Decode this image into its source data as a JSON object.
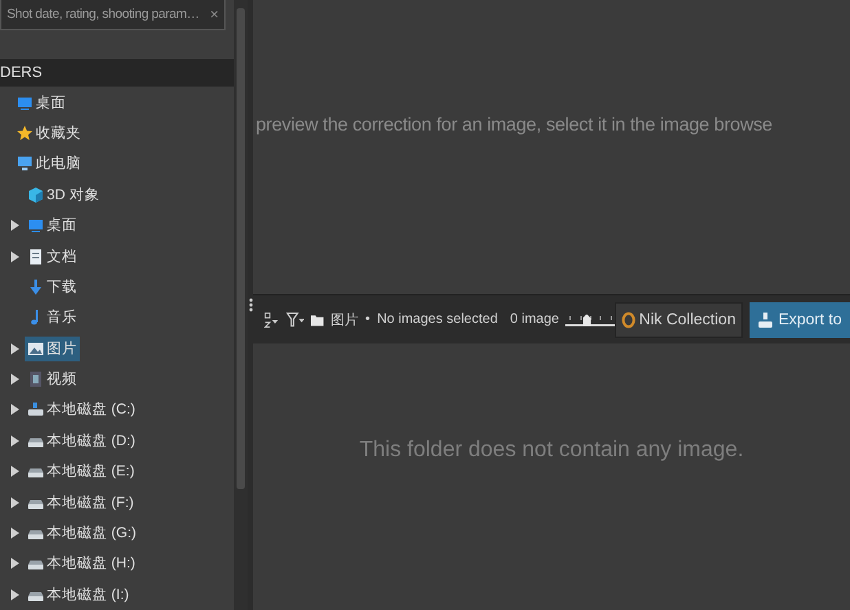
{
  "search": {
    "placeholder": "Shot date, rating, shooting param…",
    "clear": "×"
  },
  "folders": {
    "header": "DERS",
    "tree": [
      {
        "label": "桌面",
        "kind": "desktop",
        "expandable": false,
        "selected": false
      },
      {
        "label": "收藏夹",
        "kind": "star",
        "expandable": false,
        "selected": false
      },
      {
        "label": "此电脑",
        "kind": "computer",
        "expandable": false,
        "selected": false,
        "children": [
          {
            "label": "3D 对象",
            "kind": "cube",
            "expandable": false,
            "selected": false
          },
          {
            "label": "桌面",
            "kind": "desktop",
            "expandable": true,
            "selected": false
          },
          {
            "label": "文档",
            "kind": "document",
            "expandable": true,
            "selected": false
          },
          {
            "label": "下载",
            "kind": "download",
            "expandable": false,
            "selected": false
          },
          {
            "label": "音乐",
            "kind": "music",
            "expandable": false,
            "selected": false
          },
          {
            "label": "图片",
            "kind": "picture",
            "expandable": true,
            "selected": true
          },
          {
            "label": "视频",
            "kind": "video",
            "expandable": true,
            "selected": false
          },
          {
            "label": "本地磁盘 (C:)",
            "kind": "systemdrive",
            "expandable": true,
            "selected": false
          },
          {
            "label": "本地磁盘 (D:)",
            "kind": "drive",
            "expandable": true,
            "selected": false
          },
          {
            "label": "本地磁盘 (E:)",
            "kind": "drive",
            "expandable": true,
            "selected": false
          },
          {
            "label": "本地磁盘 (F:)",
            "kind": "drive",
            "expandable": true,
            "selected": false
          },
          {
            "label": "本地磁盘 (G:)",
            "kind": "drive",
            "expandable": true,
            "selected": false
          },
          {
            "label": "本地磁盘 (H:)",
            "kind": "drive",
            "expandable": true,
            "selected": false
          },
          {
            "label": "本地磁盘 (I:)",
            "kind": "drive",
            "expandable": true,
            "selected": false
          }
        ]
      }
    ]
  },
  "preview": {
    "message": "preview the correction for an image, select it in the image browse"
  },
  "toolbar": {
    "folder": "图片",
    "separator": "•",
    "selection": "No images selected",
    "count": "0 image",
    "zoom": {
      "level": 0.5
    },
    "nik_button": "Nik Collection",
    "export_button": "Export to"
  },
  "browser": {
    "empty_message": "This folder does not contain any image."
  }
}
